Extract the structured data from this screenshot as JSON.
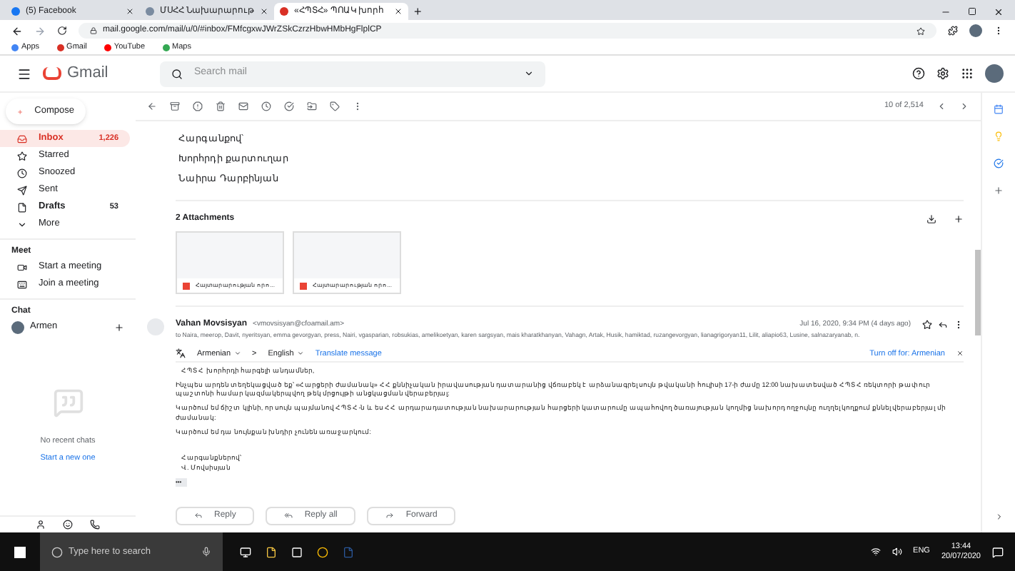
{
  "browser": {
    "tabs": [
      {
        "title": "(5) Facebook",
        "selected": false
      },
      {
        "title": "ՄՍՀՀ Նախարարութ",
        "selected": false
      },
      {
        "title": "«ՀՊՏՀ» ՊՈԱԿ խորհ",
        "selected": true
      }
    ],
    "new_tab": "+",
    "address": "mail.google.com/mail/u/0/#inbox/FMfcgxwJWrZSkCzrzHbwHMbHgFlplCP",
    "bookmarks": [
      "Apps",
      "Gmail",
      "YouTube",
      "Maps"
    ]
  },
  "gmail": {
    "logo": "Gmail",
    "search": {
      "placeholder": "Search mail"
    },
    "compose": "Compose",
    "nav": [
      {
        "label": "Inbox",
        "count": "1,226",
        "selected": true,
        "bold": true,
        "kind": "inbox"
      },
      {
        "label": "Starred",
        "selected": false,
        "bold": false,
        "kind": "star"
      },
      {
        "label": "Snoozed",
        "selected": false,
        "bold": false,
        "kind": "clock"
      },
      {
        "label": "Sent",
        "selected": false,
        "bold": false,
        "kind": "send"
      },
      {
        "label": "Drafts",
        "count": "53",
        "selected": false,
        "bold": true,
        "kind": "file"
      },
      {
        "label": "More",
        "selected": false,
        "bold": false,
        "kind": "more"
      }
    ],
    "meet": {
      "title": "Meet",
      "items": [
        {
          "label": "Start a meeting",
          "kind": "video"
        },
        {
          "label": "Join a meeting",
          "kind": "keyboard"
        }
      ]
    },
    "chat": {
      "title": "Chat",
      "user": "Armen",
      "empty": "No recent chats",
      "start": "Start a new one"
    },
    "counter": "10 of 2,514",
    "signature": [
      "Հարգանքով՝",
      "Խորհրդի քարտուղար",
      "Նաիրա Դարբինյան"
    ],
    "attachments": {
      "title": "2 Attachments",
      "files": [
        "Հայտարարության որո...",
        "Հայտարարության որո..."
      ]
    },
    "message": {
      "sender": "Vahan Movsisyan",
      "email": "<vmovsisyan@cfoamail.am>",
      "date": "Jul 16, 2020, 9:34 PM (4 days ago)",
      "to": "to Naira, meerop, Davit, nyeritsyan, emma gevorgyan, press, Nairi, vgasparian, robsukias, amelikoetyan, karen sargsyan, mais kharatkhanyan, Vahagn, Artak, Husik, hamiktad, ruzangevorgyan, lianagrigoryan11, Lilit, aliapio63, Lusine, salnazaryanab, n.",
      "translate": {
        "from": "Armenian",
        "arrow": ">",
        "to": "English",
        "action": "Translate message",
        "off": "Turn off for: Armenian"
      },
      "greeting": "ՀՊՏՀ խորհրդի հարգելի անդամներ,",
      "paragraphs": [
        "Ինչպես արդեն տեղեկացված եք՝ «Հարցերի ժամանակ» ՀՀ քննիչական իրավասության դատարանից վճռաբեկ է արձանագրել սույն թվականի հուլիսի 17-ի ժամը 12:00 նախատեսված ՀՊՏՀ ռեկտորի թափուր պաշտոնի համար կազմակերպվող թեկ մրցույթի անցկացման վերաբերյալ:",
        "Կարծում եմ ճիշտ կլինի, որ սույն պայմանով ՀՊՏՀ-ն և ես ՀՀ արդարադատության նախարարության հարցերի կատարումը ապահովող ծառայության կողմից նախորդ ողջույնը ուղղել կողքում քննել վերաբերյալ մի ժամանակ:",
        "Կարծում եմ դա նույնքան խնդիր չունեն առաջարկում:"
      ],
      "closing": [
        "Հարգանքներով՝",
        "Վ. Մովսիսյան"
      ],
      "ellipsis": "•••"
    },
    "actions": [
      "Reply",
      "Reply all",
      "Forward"
    ]
  },
  "taskbar": {
    "search": "Type here to search",
    "lang": "ENG",
    "time": "13:44",
    "date": "20/07/2020"
  }
}
